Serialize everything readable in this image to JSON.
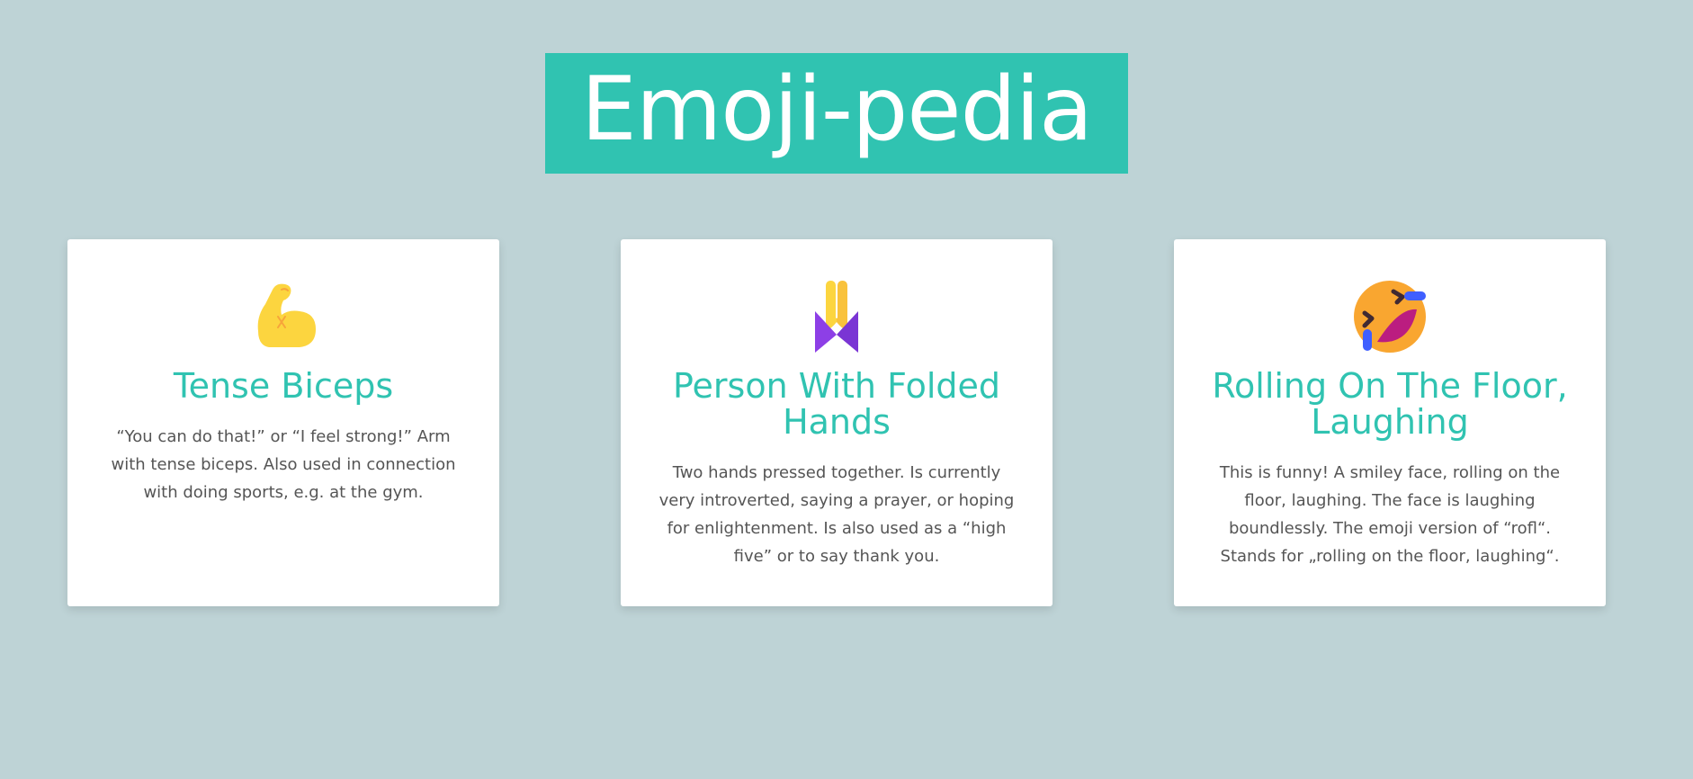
{
  "page": {
    "title": "Emoji-pedia",
    "title_bg_color": "#30c3b1",
    "background_color": "#bed3d6",
    "accent_color": "#30c3b1"
  },
  "cards": [
    {
      "icon": "flexed-biceps-emoji",
      "title": "Tense Biceps",
      "description": "“You can do that!” or “I feel strong!” Arm with tense biceps. Also used in connection with doing sports, e.g. at the gym."
    },
    {
      "icon": "folded-hands-emoji",
      "title": "Person With Folded Hands",
      "description": "Two hands pressed together. Is currently very introverted, saying a prayer, or hoping for enlightenment. Is also used as a “high five” or to say thank you."
    },
    {
      "icon": "rolling-on-the-floor-laughing-emoji",
      "title": "Rolling On The Floor, Laughing",
      "description": "This is funny! A smiley face, rolling on the floor, laughing. The face is laughing boundlessly. The emoji version of “rofl“. Stands for „rolling on the floor, laughing“."
    }
  ]
}
